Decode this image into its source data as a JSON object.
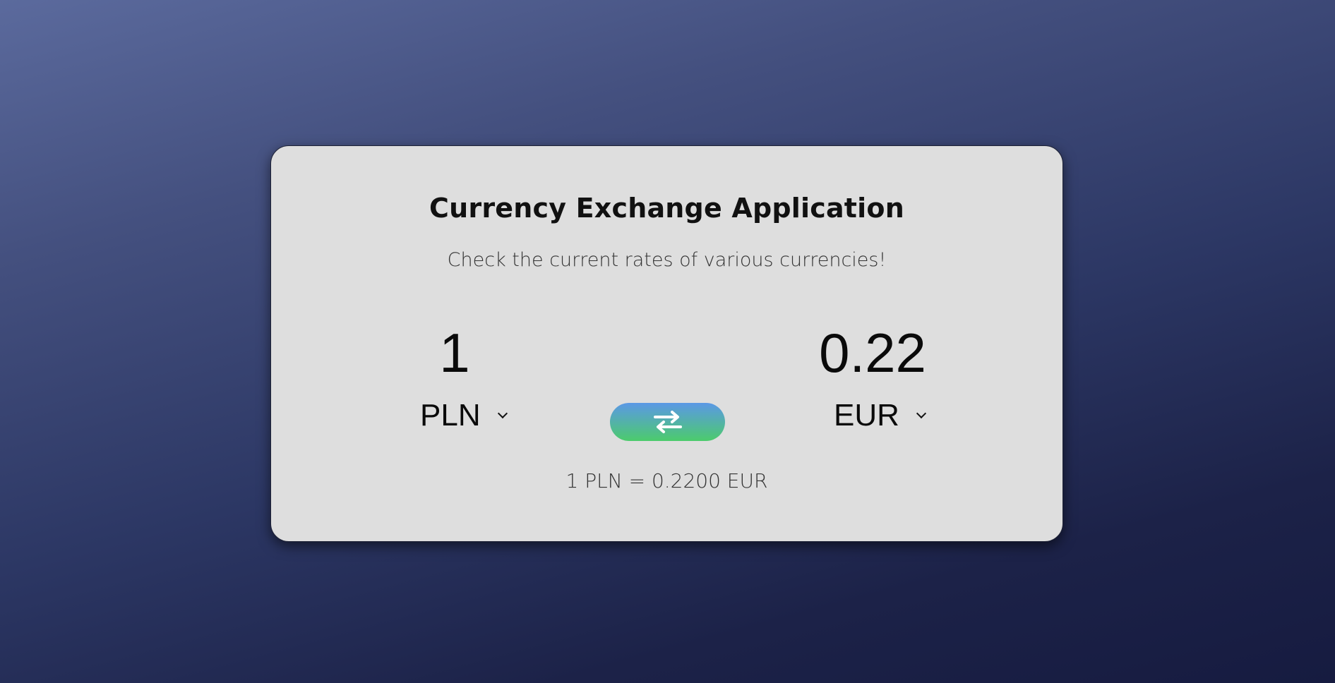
{
  "app": {
    "title": "Currency Exchange Application",
    "subtitle": "Check the current rates of various currencies!"
  },
  "converter": {
    "from_amount": "1",
    "to_amount": "0.22",
    "from_currency": "PLN",
    "to_currency": "EUR",
    "rate_text": "1 PLN = 0.2200 EUR"
  },
  "icons": {
    "swap": "swap-arrows-icon",
    "dropdown": "chevron-down-icon"
  },
  "colors": {
    "card_bg": "#dedede",
    "swap_gradient_top": "#5b98e6",
    "swap_gradient_bottom": "#4ccb6c",
    "page_bg_top": "#5b6a9d",
    "page_bg_bottom": "#161b40"
  }
}
